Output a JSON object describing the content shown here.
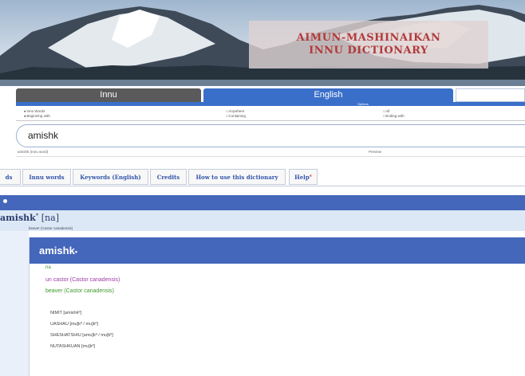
{
  "banner": {
    "title_line1": "AIMUN-MASHINAIKAN",
    "title_line2": "INNU DICTIONARY"
  },
  "language_tabs": {
    "innu": "Innu",
    "english": "English",
    "options_label": "Options"
  },
  "search_options": {
    "col1": [
      "Innu Words",
      "Beginning with"
    ],
    "col2": [
      "Anywhere",
      "Containing"
    ],
    "col3": [
      "All",
      "Ending with"
    ]
  },
  "search": {
    "value": "amishk",
    "suggest_left": "amishk (Innu word)",
    "suggest_right": "Preview"
  },
  "nav_tabs": [
    "ds",
    "Innu words",
    "Keywords (English)",
    "Credits",
    "How to use this dictionary",
    "Help"
  ],
  "result": {
    "headword": "amishk",
    "headword_mark": "*",
    "pos_tag": "[na]",
    "subtitle": "beaver (Castor canadensis)"
  },
  "detail": {
    "word": "amishk",
    "word_mark": "•",
    "pos": "na",
    "french": "un castor (Castor canadensis)",
    "english": "beaver (Castor canadensis)",
    "forms": [
      "NIMIT [amishkº]",
      "UASHAU [mu]kº / mu]kº]",
      "SHESHATSHIU [amu]kº / mu]kº]",
      "NUTASHKUAN [mu]kº]"
    ]
  },
  "colors": {
    "accent_blue": "#3a6fc9",
    "result_blue": "#4466bb",
    "title_red": "#b23a3a",
    "french_purple": "#a03aa8",
    "english_green": "#3a9a2a"
  }
}
